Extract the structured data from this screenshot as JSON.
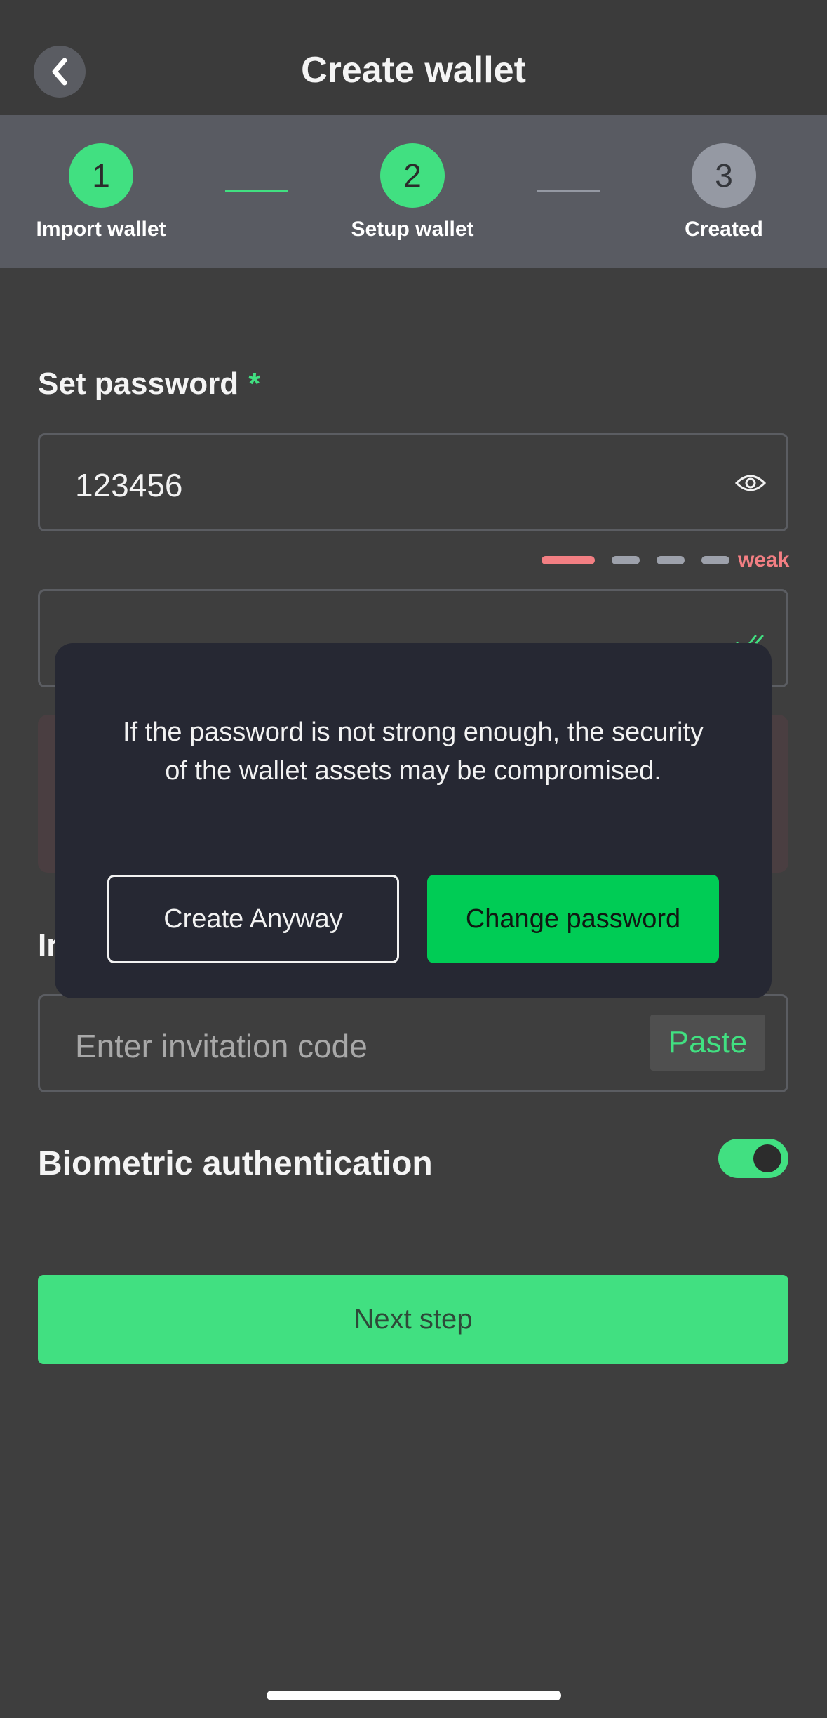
{
  "header": {
    "title": "Create wallet",
    "back_icon": "chevron-left-icon"
  },
  "stepper": {
    "steps": [
      {
        "number": "1",
        "label": "Import wallet",
        "state": "done"
      },
      {
        "number": "2",
        "label": "Setup wallet",
        "state": "current"
      },
      {
        "number": "3",
        "label": "Created",
        "state": "pending"
      }
    ],
    "colors": {
      "done": "#41e081",
      "pending": "#9599a3"
    }
  },
  "password": {
    "label": "Set password",
    "required_mark": "*",
    "value": "123456",
    "toggle_icon": "eye-icon",
    "strength_label": "weak",
    "strength_level": 1,
    "strength_total": 4
  },
  "confirm_password": {
    "value": "",
    "status_icon": "check-icon"
  },
  "invitation": {
    "label": "Ir",
    "placeholder": "Enter invitation code",
    "paste_label": "Paste"
  },
  "biometric": {
    "label": "Biometric authentication",
    "enabled": true
  },
  "next_button": {
    "label": "Next step"
  },
  "dialog": {
    "message": "If the password is not strong enough, the security of the wallet assets may be compromised.",
    "secondary_label": "Create Anyway",
    "primary_label": "Change password"
  },
  "colors": {
    "accent": "#41e081",
    "primary_button": "#00cc55",
    "weak": "#f37f83",
    "background": "#3e3e3e",
    "dialog": "#262833"
  }
}
